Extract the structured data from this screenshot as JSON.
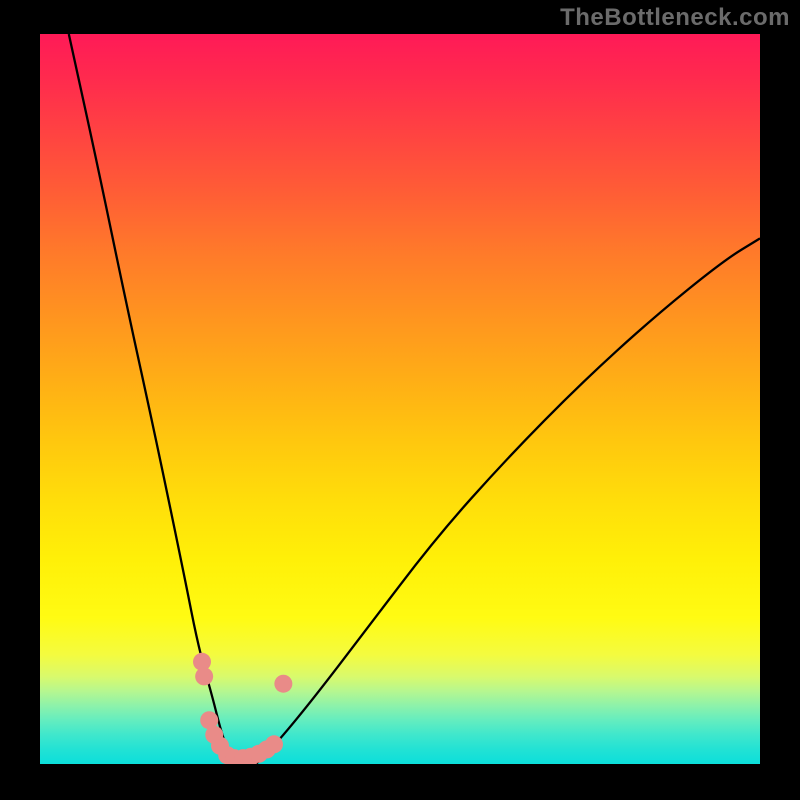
{
  "watermark": "TheBottleneck.com",
  "chart_data": {
    "type": "line",
    "title": "",
    "xlabel": "",
    "ylabel": "",
    "xlim": [
      0,
      100
    ],
    "ylim": [
      0,
      100
    ],
    "grid": false,
    "legend": false,
    "notes": "Bottleneck V-curve over a rainbow gradient. Y is mismatch percentage (top=100%, bottom=0%). Minimum around x≈27.",
    "gradient": {
      "direction": "vertical",
      "stops": [
        {
          "pos": 0,
          "color": "#ff1a57"
        },
        {
          "pos": 20,
          "color": "#ff6a30"
        },
        {
          "pos": 45,
          "color": "#ffb015"
        },
        {
          "pos": 70,
          "color": "#ffef08"
        },
        {
          "pos": 90,
          "color": "#b6f78f"
        },
        {
          "pos": 100,
          "color": "#0cdfdb"
        }
      ]
    },
    "series": [
      {
        "name": "left-branch",
        "color": "#000000",
        "x": [
          4,
          8,
          12,
          16,
          20,
          22,
          24,
          25,
          26,
          27
        ],
        "y": [
          100,
          82,
          63,
          45,
          26,
          16,
          9,
          5,
          2,
          0
        ]
      },
      {
        "name": "right-branch",
        "color": "#000000",
        "x": [
          30,
          33,
          38,
          45,
          55,
          65,
          75,
          85,
          95,
          100
        ],
        "y": [
          0,
          3,
          9,
          18,
          31,
          42,
          52,
          61,
          69,
          72
        ]
      }
    ],
    "markers": [
      {
        "name": "pink-dot",
        "color": "#e98b88",
        "x": 22.5,
        "y": 14
      },
      {
        "name": "pink-dot",
        "color": "#e98b88",
        "x": 22.8,
        "y": 12
      },
      {
        "name": "pink-dot",
        "color": "#e98b88",
        "x": 23.5,
        "y": 6
      },
      {
        "name": "pink-dot",
        "color": "#e98b88",
        "x": 24.2,
        "y": 4
      },
      {
        "name": "pink-dot",
        "color": "#e98b88",
        "x": 25.0,
        "y": 2.5
      },
      {
        "name": "pink-dot",
        "color": "#e98b88",
        "x": 26.0,
        "y": 1.2
      },
      {
        "name": "pink-dot",
        "color": "#e98b88",
        "x": 27.0,
        "y": 0.8
      },
      {
        "name": "pink-dot",
        "color": "#e98b88",
        "x": 28.2,
        "y": 0.8
      },
      {
        "name": "pink-dot",
        "color": "#e98b88",
        "x": 29.3,
        "y": 1.0
      },
      {
        "name": "pink-dot",
        "color": "#e98b88",
        "x": 30.4,
        "y": 1.4
      },
      {
        "name": "pink-dot",
        "color": "#e98b88",
        "x": 31.5,
        "y": 2.0
      },
      {
        "name": "pink-dot",
        "color": "#e98b88",
        "x": 32.5,
        "y": 2.7
      },
      {
        "name": "pink-dot",
        "color": "#e98b88",
        "x": 33.8,
        "y": 11
      }
    ]
  }
}
